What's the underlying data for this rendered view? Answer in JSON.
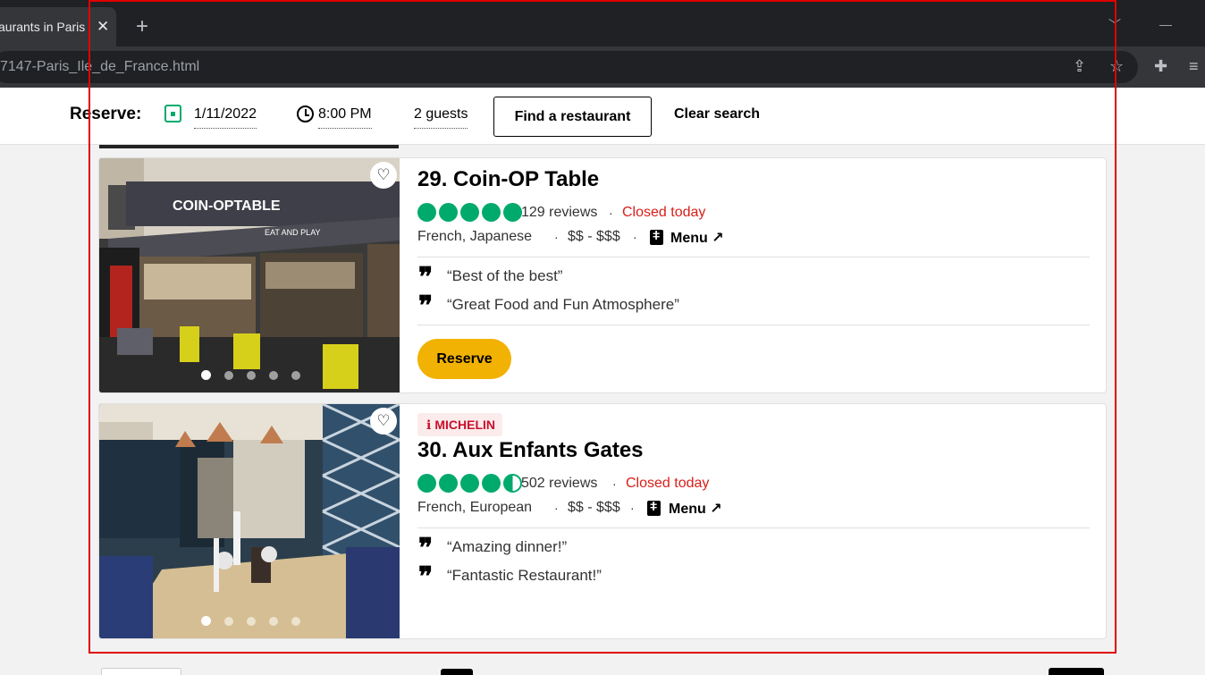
{
  "browser": {
    "tab_title": "aurants in Paris",
    "tab_close": "✕",
    "new_tab": "+",
    "url": "7147-Paris_Ile_de_France.html"
  },
  "reserve_bar": {
    "label": "Reserve:",
    "date": "1/11/2022",
    "time": "8:00 PM",
    "guests": "2 guests",
    "find_button": "Find a restaurant",
    "clear_button": "Clear search"
  },
  "restaurants": [
    {
      "rank_name": "29. Coin-OP Table",
      "rating_bubbles": 5,
      "reviews": "129 reviews",
      "status": "Closed today",
      "cuisine": "French, Japanese",
      "price": "$$ - $$$",
      "menu_label": "Menu ↗",
      "quotes": [
        "“Best of the best”",
        "“Great Food and Fun Atmosphere”"
      ],
      "reserve_label": "Reserve",
      "photo_index": 1,
      "photo_count": 5,
      "sign_text": "COIN-OPTABLE",
      "sign_sub": "EAT AND PLAY"
    },
    {
      "badge": "MICHELIN",
      "rank_name": "30. Aux Enfants Gates",
      "rating_bubbles": 4.5,
      "reviews": "502 reviews",
      "status": "Closed today",
      "cuisine": "French, European",
      "price": "$$ - $$$",
      "menu_label": "Menu ↗",
      "quotes": [
        "“Amazing dinner!”",
        "“Fantastic Restaurant!”"
      ],
      "photo_index": 1,
      "photo_count": 5
    }
  ],
  "colors": {
    "rating_green": "#00aa6c",
    "closed_red": "#d91e18",
    "reserve_yellow": "#f2b203",
    "michelin_red": "#c8102e",
    "annotation_frame": "#e00000"
  },
  "icons": {
    "calendar": "calendar-icon",
    "clock": "clock-icon",
    "heart": "heart-icon",
    "quote": "quote-icon",
    "menu": "menu-book-icon",
    "michelin": "michelin-icon"
  }
}
